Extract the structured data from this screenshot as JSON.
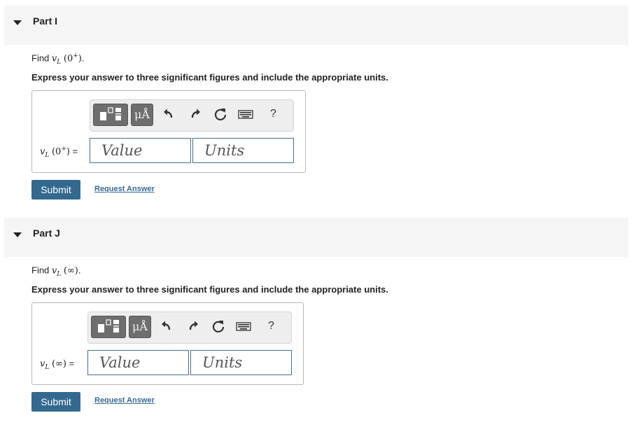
{
  "parts": [
    {
      "title": "Part I",
      "find_prefix": "Find ",
      "var": "v",
      "var_sub": "L",
      "arg": "(0",
      "arg_sup": "+",
      "arg_close": ")",
      "find_suffix": ".",
      "instruction": "Express your answer to three significant figures and include the appropriate units.",
      "answer_label_suffix": " =",
      "value_placeholder": "Value",
      "units_placeholder": "Units",
      "submit_label": "Submit",
      "request_label": "Request Answer"
    },
    {
      "title": "Part J",
      "find_prefix": "Find ",
      "var": "v",
      "var_sub": "L",
      "arg": "(∞",
      "arg_sup": "",
      "arg_close": ")",
      "find_suffix": ".",
      "instruction": "Express your answer to three significant figures and include the appropriate units.",
      "answer_label_suffix": " =",
      "value_placeholder": "Value",
      "units_placeholder": "Units",
      "submit_label": "Submit",
      "request_label": "Request Answer"
    }
  ],
  "toolbar": {
    "units_button": "μÅ",
    "help": "?",
    "icons": [
      "templates-icon",
      "units-icon",
      "undo-icon",
      "redo-icon",
      "reset-icon",
      "keyboard-icon",
      "help-icon"
    ]
  },
  "colors": {
    "submit_bg": "#34698f",
    "link": "#3a6b94",
    "header_bg": "#f5f5f5",
    "field_border": "#4a6e8a"
  }
}
